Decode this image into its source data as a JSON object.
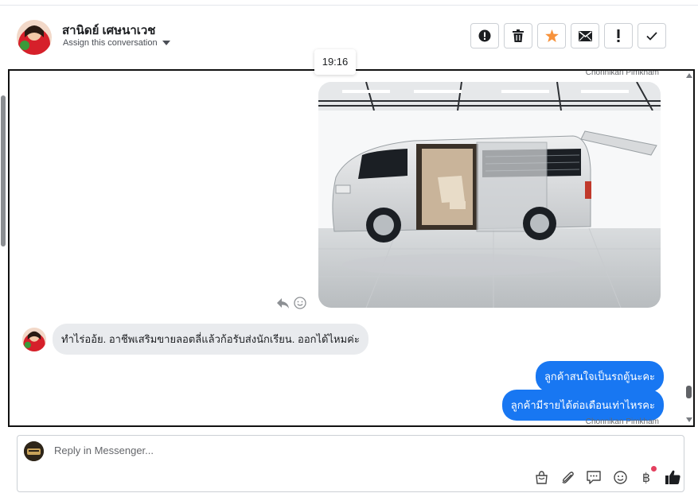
{
  "header": {
    "contact_name": "สานิดย์ เศษนาเวช",
    "assign_label": "Assign this conversation",
    "actions": [
      {
        "name": "spam-icon"
      },
      {
        "name": "trash-icon"
      },
      {
        "name": "star-icon",
        "color": "#f7923b"
      },
      {
        "name": "mail-icon"
      },
      {
        "name": "follow-up-icon"
      },
      {
        "name": "check-icon"
      }
    ]
  },
  "tooltip": {
    "time": "19:16"
  },
  "thread": {
    "sender_top": "Chonnikan Pimkham",
    "incoming_message": "ทำไร่ออ้ย.  อาชีพเสริมขายลอตลี่แล้วก้อรับส่งนักเรียน. ออกได้ไหมค่ะ",
    "outgoing_messages": [
      "ลูกค้าสนใจเป็นรถตู้นะคะ",
      "ลูกค้ามีรายได้ต่อเดือนเท่าไหรคะ"
    ],
    "sender_bottom": "Chonnikan Pimkham"
  },
  "composer": {
    "placeholder": "Reply in Messenger...",
    "currency_symbol": "฿",
    "tools": [
      "shopping-bag-icon",
      "paperclip-icon",
      "saved-replies-icon",
      "emoji-icon",
      "baht-icon",
      "like-icon"
    ]
  },
  "colors": {
    "accent": "#1877f2",
    "bubble_in": "#e9ebee",
    "star": "#f7923b",
    "notification": "#e4405f"
  }
}
